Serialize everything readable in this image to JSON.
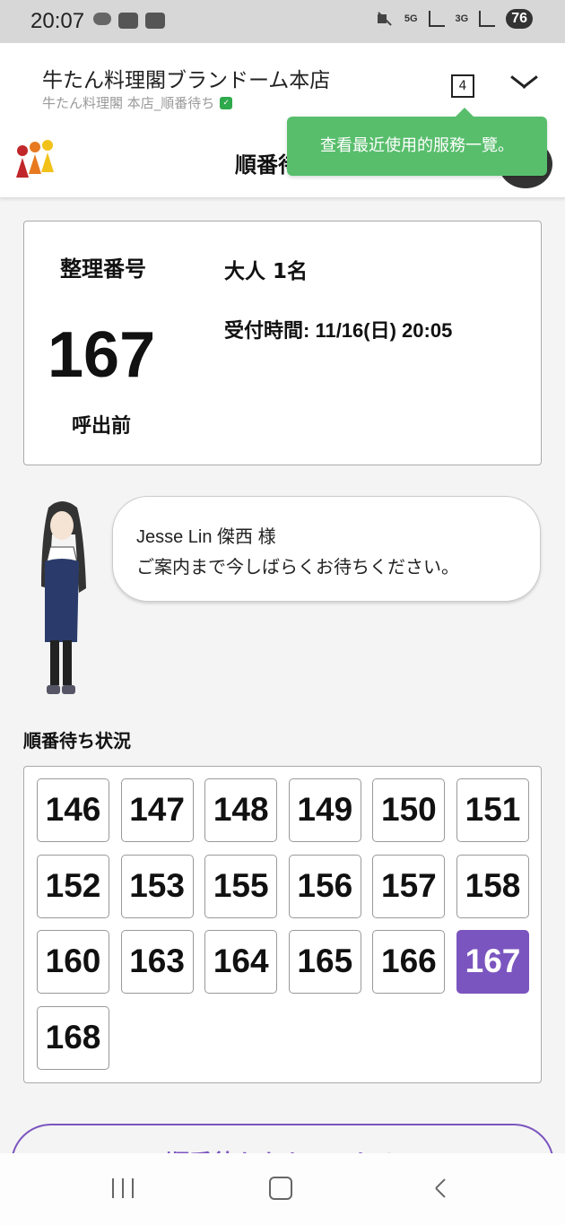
{
  "status_bar": {
    "time": "20:07",
    "network_5g": "5G",
    "network_3g": "3G",
    "battery": "76"
  },
  "browser": {
    "title": "牛たん料理閣ブランドーム本店",
    "subtitle": "牛たん料理閣 本店_順番待ち",
    "tab_count": "4",
    "tooltip": "查看最近使用的服務一覽。"
  },
  "header": {
    "title": "順番待ち"
  },
  "ticket": {
    "number_label": "整理番号",
    "number": "167",
    "status": "呼出前",
    "party": "大人 1名",
    "reception_time": "受付時間: 11/16(日) 20:05"
  },
  "message": {
    "line1": "Jesse Lin 傑西 様",
    "line2": "ご案内まで今しばらくお待ちください。"
  },
  "queue": {
    "title": "順番待ち状況",
    "numbers": [
      "146",
      "147",
      "148",
      "149",
      "150",
      "151",
      "152",
      "153",
      "155",
      "156",
      "157",
      "158",
      "160",
      "163",
      "164",
      "165",
      "166",
      "167",
      "168"
    ],
    "current": "167"
  },
  "cancel_button": {
    "label": "順番待ちをキャンセル"
  },
  "colors": {
    "accent": "#7b55bf",
    "tooltip": "#58be6c"
  }
}
